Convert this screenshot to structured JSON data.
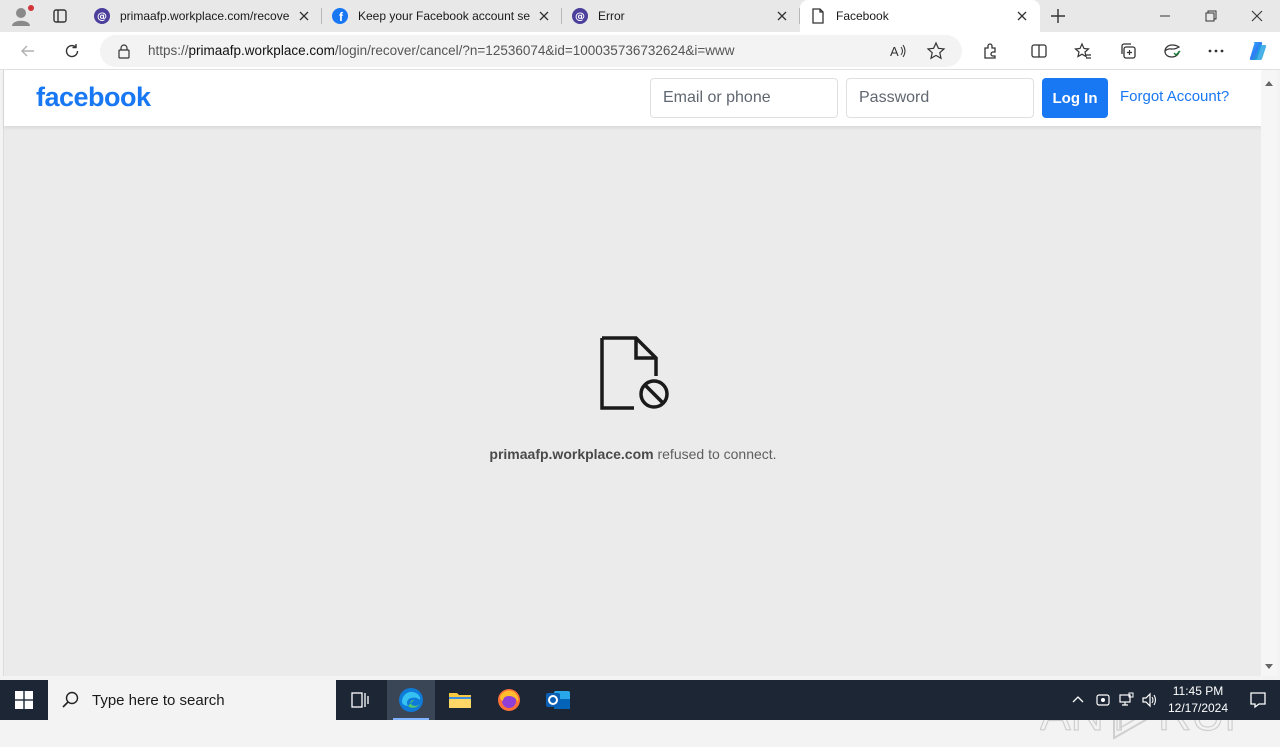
{
  "browser": {
    "tabs": [
      {
        "title": "primaafp.workplace.com/recove",
        "icon": "workplace-icon"
      },
      {
        "title": "Keep your Facebook account sec",
        "icon": "facebook-icon"
      },
      {
        "title": "Error",
        "icon": "workplace-icon"
      },
      {
        "title": "Facebook",
        "icon": "page-icon"
      }
    ],
    "address": {
      "prefix": "https://",
      "host": "primaafp.workplace.com",
      "path": "/login/recover/cancel/?n=12536074&id=100035736732624&i=www"
    }
  },
  "fb": {
    "logo": "facebook",
    "email_placeholder": "Email or phone",
    "password_placeholder": "Password",
    "login_label": "Log In",
    "forgot_label": "Forgot Account?"
  },
  "error": {
    "host": "primaafp.workplace.com",
    "message": " refused to connect."
  },
  "watermark": "ANY RUN",
  "taskbar": {
    "search_placeholder": "Type here to search",
    "time": "11:45 PM",
    "date": "12/17/2024"
  },
  "colors": {
    "fb_blue": "#1877f2",
    "taskbar": "#1c2634",
    "page_bg": "#ebebeb"
  }
}
